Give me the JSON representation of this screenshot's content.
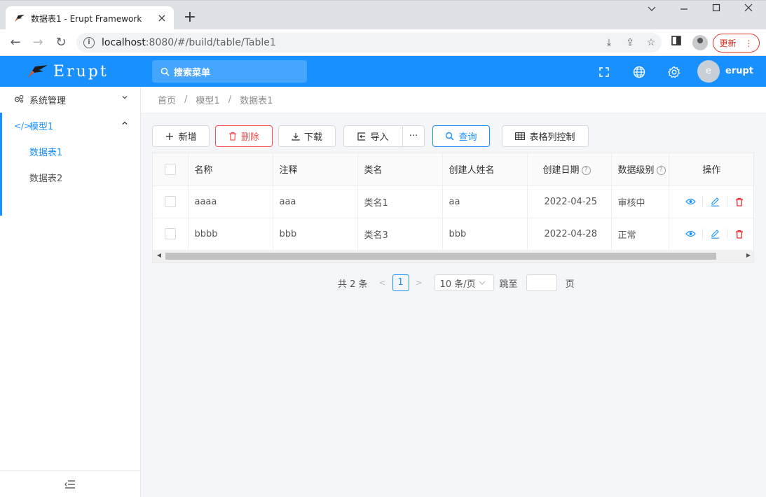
{
  "browser": {
    "tab_title": "数据表1 - Erupt Framework",
    "url_host": "localhost",
    "url_rest": ":8080/#/build/table/Table1",
    "update_label": "更新"
  },
  "header": {
    "logo_text": "Erupt",
    "search_placeholder": "搜索菜单",
    "avatar_letter": "e",
    "username": "erupt",
    "accent_color": "#1890ff"
  },
  "sidebar": {
    "items": [
      {
        "label": "系统管理",
        "icon": "cogs-icon"
      },
      {
        "label": "模型1",
        "icon": "code-icon"
      }
    ],
    "subitems": [
      {
        "label": "数据表1"
      },
      {
        "label": "数据表2"
      }
    ]
  },
  "breadcrumb": [
    "首页",
    "模型1",
    "数据表1"
  ],
  "toolbar": {
    "add": "新增",
    "delete": "删除",
    "download": "下载",
    "import": "导入",
    "more": "···",
    "query": "查询",
    "columns": "表格列控制"
  },
  "table": {
    "headers": [
      "名称",
      "注释",
      "类名",
      "创建人姓名",
      "创建日期",
      "数据级别",
      "操作"
    ],
    "rows": [
      [
        "aaaa",
        "aaa",
        "类名1",
        "aa",
        "2022-04-25",
        "审核中"
      ],
      [
        "bbbb",
        "bbb",
        "类名3",
        "bbb",
        "2022-04-28",
        "正常"
      ]
    ]
  },
  "pager": {
    "total": "共 2 条",
    "current": "1",
    "size": "10 条/页",
    "jump": "跳至",
    "page_unit": "页"
  }
}
